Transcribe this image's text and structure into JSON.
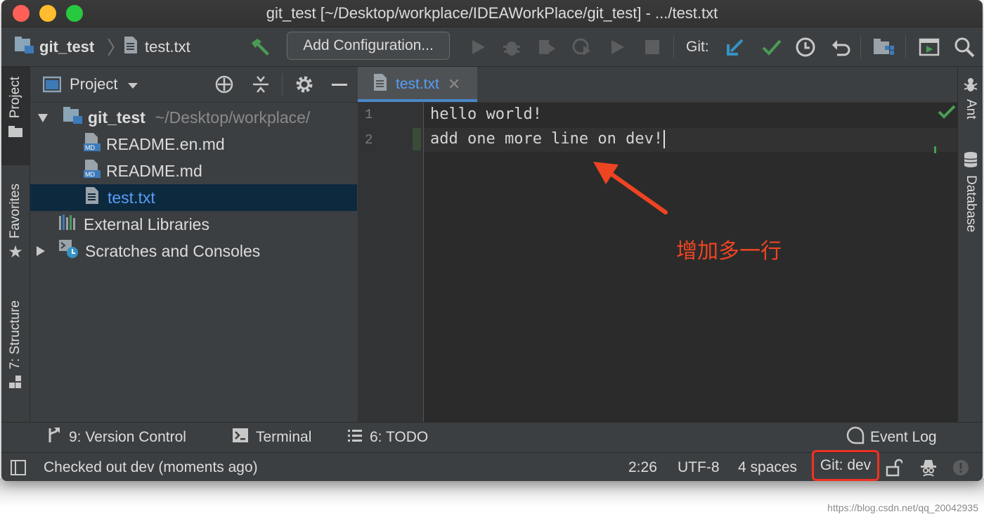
{
  "window": {
    "title": "git_test [~/Desktop/workplace/IDEAWorkPlace/git_test] - .../test.txt"
  },
  "navbar": {
    "project_crumb": "git_test",
    "file_crumb": "test.txt",
    "add_configuration_label": "Add Configuration...",
    "git_label": "Git:"
  },
  "left_strip": {
    "project": "Project",
    "favorites": "Favorites",
    "structure": "7: Structure"
  },
  "right_strip": {
    "ant": "Ant",
    "database": "Database"
  },
  "project_panel": {
    "view_label": "Project",
    "tree": [
      {
        "label": "git_test",
        "hint": "~/Desktop/workplace/",
        "icon": "folder-module-icon"
      },
      {
        "label": "README.en.md",
        "icon": "markdown-file-icon"
      },
      {
        "label": "README.md",
        "icon": "markdown-file-icon"
      },
      {
        "label": "test.txt",
        "icon": "text-file-icon",
        "selected": true
      },
      {
        "label": "External Libraries",
        "icon": "library-icon"
      },
      {
        "label": "Scratches and Consoles",
        "icon": "scratches-icon"
      }
    ]
  },
  "editor": {
    "tab_label": "test.txt",
    "lines": [
      {
        "number": "1",
        "text": "hello world!"
      },
      {
        "number": "2",
        "text": "add one more line on dev!"
      }
    ],
    "annotation": "增加多一行"
  },
  "tool_windows": {
    "version_control": "9: Version Control",
    "terminal": "Terminal",
    "todo": "6: TODO",
    "event_log": "Event Log"
  },
  "status_bar": {
    "message": "Checked out dev (moments ago)",
    "position": "2:26",
    "encoding": "UTF-8",
    "indent": "4 spaces",
    "git_branch": "Git: dev"
  },
  "watermark": "https://blog.csdn.net/qq_20042935",
  "colors": {
    "accent_blue": "#589df6",
    "annotation_red": "#ee4422",
    "git_green": "#499c54"
  }
}
